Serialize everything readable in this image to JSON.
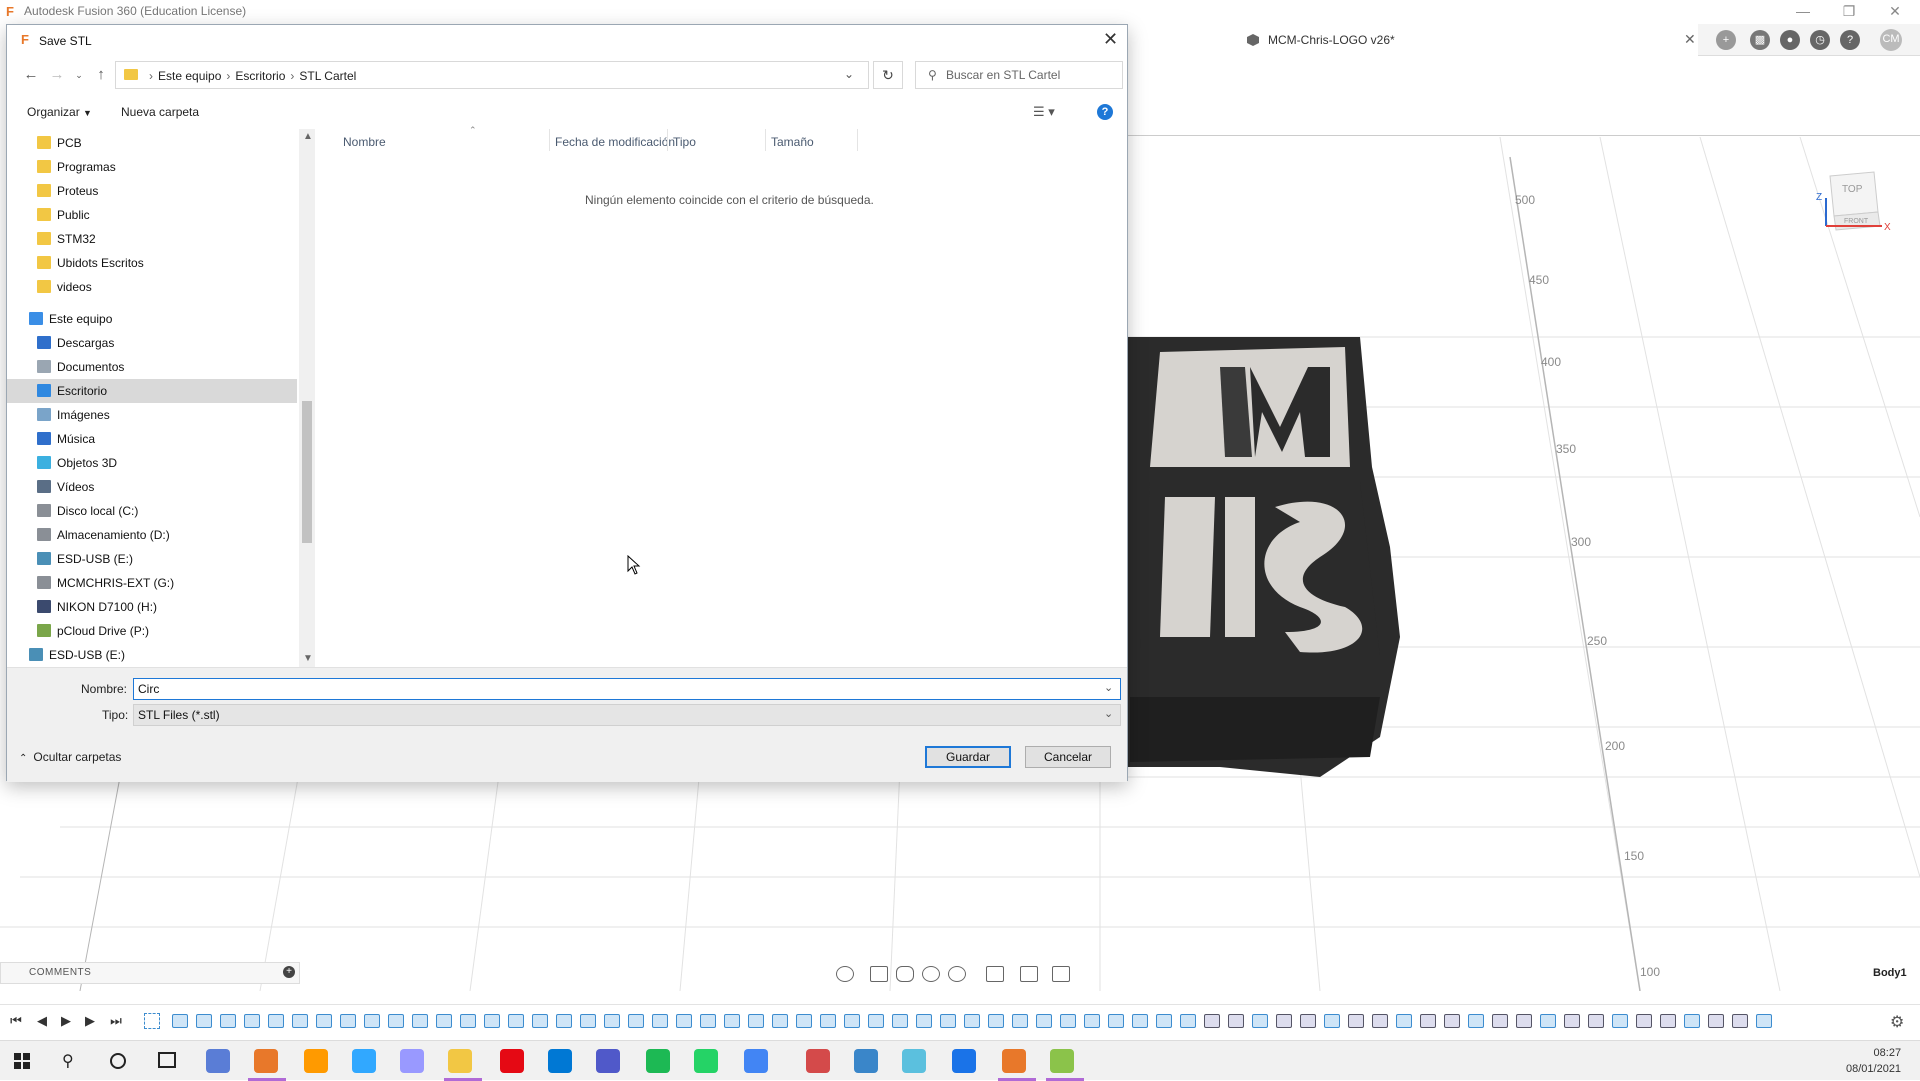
{
  "app": {
    "title": "Autodesk Fusion 360 (Education License)",
    "document_tab": "MCM-Chris-LOGO v26*",
    "user_initials": "CM",
    "body_label": "Body1",
    "comments_label": "COMMENTS",
    "axis_ticks": [
      "500",
      "450",
      "400",
      "350",
      "300",
      "250",
      "200",
      "150",
      "100"
    ],
    "viewcube": {
      "top": "TOP",
      "front": "FRONT",
      "x_axis": "X",
      "z_axis": "Z"
    }
  },
  "dialog": {
    "title": "Save STL",
    "breadcrumb": [
      "Este equipo",
      "Escritorio",
      "STL Cartel"
    ],
    "search_placeholder": "Buscar en STL Cartel",
    "organize_label": "Organizar",
    "new_folder_label": "Nueva carpeta",
    "columns": [
      "Nombre",
      "Fecha de modificación",
      "Tipo",
      "Tamaño"
    ],
    "empty_message": "Ningún elemento coincide con el criterio de búsqueda.",
    "name_label": "Nombre:",
    "name_value": "Circ",
    "type_label": "Tipo:",
    "type_value": "STL Files (*.stl)",
    "hide_folders_label": "Ocultar carpetas",
    "save_button": "Guardar",
    "cancel_button": "Cancelar",
    "nav_items": [
      {
        "label": "PCB",
        "icon": "folder-icon"
      },
      {
        "label": "Programas",
        "icon": "folder-synced-icon"
      },
      {
        "label": "Proteus",
        "icon": "folder-icon"
      },
      {
        "label": "Public",
        "icon": "folder-synced-icon"
      },
      {
        "label": "STM32",
        "icon": "folder-synced-icon"
      },
      {
        "label": "Ubidots Escritos",
        "icon": "folder-synced-icon"
      },
      {
        "label": "videos",
        "icon": "folder-icon"
      },
      {
        "label": "Este equipo",
        "icon": "computer-icon"
      },
      {
        "label": "Descargas",
        "icon": "downloads-icon"
      },
      {
        "label": "Documentos",
        "icon": "documents-icon"
      },
      {
        "label": "Escritorio",
        "icon": "desktop-icon"
      },
      {
        "label": "Imágenes",
        "icon": "pictures-icon"
      },
      {
        "label": "Música",
        "icon": "music-icon"
      },
      {
        "label": "Objetos 3D",
        "icon": "objects-3d-icon"
      },
      {
        "label": "Vídeos",
        "icon": "videos-icon"
      },
      {
        "label": "Disco local (C:)",
        "icon": "drive-icon"
      },
      {
        "label": "Almacenamiento (D:)",
        "icon": "drive-icon"
      },
      {
        "label": "ESD-USB (E:)",
        "icon": "usb-drive-icon"
      },
      {
        "label": "MCMCHRIS-EXT (G:)",
        "icon": "drive-icon"
      },
      {
        "label": "NIKON D7100 (H:)",
        "icon": "camera-icon"
      },
      {
        "label": "pCloud Drive (P:)",
        "icon": "cloud-drive-icon"
      },
      {
        "label": "ESD-USB (E:)",
        "icon": "usb-drive-icon"
      }
    ]
  },
  "taskbar": {
    "time": "08:27",
    "date": "08/01/2021",
    "apps": [
      {
        "name": "fusion-app-icon",
        "color": "#e8782a"
      },
      {
        "name": "illustrator-icon",
        "color": "#ff9a00"
      },
      {
        "name": "photoshop-icon",
        "color": "#31a8ff"
      },
      {
        "name": "premiere-icon",
        "color": "#9999ff"
      },
      {
        "name": "file-explorer-icon",
        "color": "#f2c744"
      },
      {
        "name": "netflix-icon",
        "color": "#e50914"
      },
      {
        "name": "mail-icon",
        "color": "#0078d4"
      },
      {
        "name": "teams-icon",
        "color": "#5059c9"
      },
      {
        "name": "spotify-icon",
        "color": "#1db954"
      },
      {
        "name": "whatsapp-icon",
        "color": "#25d366"
      },
      {
        "name": "chrome-icon",
        "color": "#4285f4"
      }
    ]
  },
  "colors": {
    "accent": "#1e78d7",
    "selected_row": "#d9d9d9",
    "model_dark": "#2b2b2b",
    "model_light": "#d6d3cf"
  }
}
